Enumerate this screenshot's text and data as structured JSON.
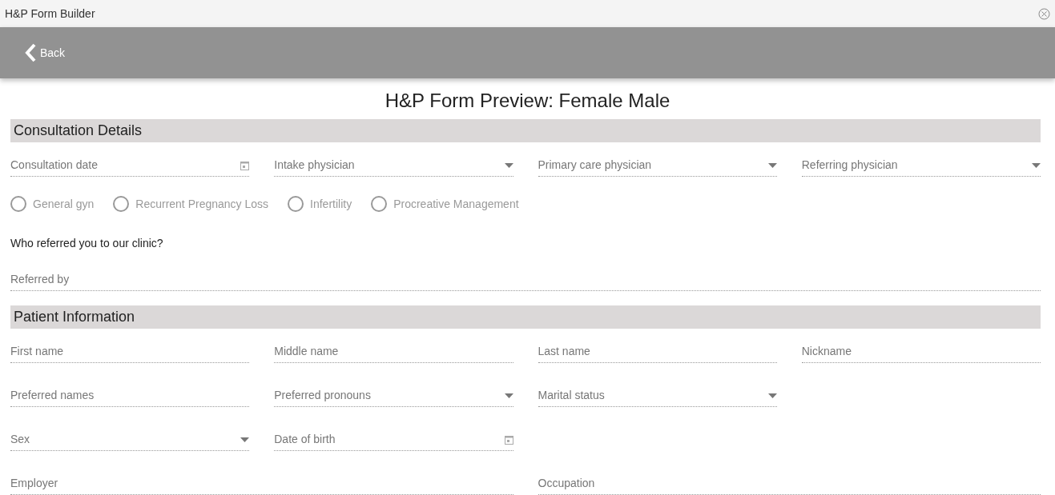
{
  "window": {
    "title": "H&P Form Builder"
  },
  "header": {
    "back_label": "Back"
  },
  "page_title": "H&P Form Preview: Female Male",
  "sections": [
    {
      "title": "Consultation Details",
      "blocks": [
        {
          "kind": "quarters",
          "fields": [
            {
              "kind": "date",
              "placeholder": "Consultation date"
            },
            {
              "kind": "select",
              "placeholder": "Intake physician"
            },
            {
              "kind": "select",
              "placeholder": "Primary care physician"
            },
            {
              "kind": "select",
              "placeholder": "Referring physician"
            }
          ]
        },
        {
          "kind": "radios",
          "options": [
            {
              "label": "General gyn",
              "selected": false,
              "disabled": true
            },
            {
              "label": "Recurrent Pregnancy Loss",
              "selected": false,
              "disabled": true
            },
            {
              "label": "Infertility",
              "selected": false,
              "disabled": true
            },
            {
              "label": "Procreative Management",
              "selected": false,
              "disabled": true
            }
          ]
        },
        {
          "kind": "question",
          "text": "Who referred you to our clinic?"
        },
        {
          "kind": "full",
          "fields": [
            {
              "kind": "text",
              "placeholder": "Referred by"
            }
          ]
        }
      ]
    },
    {
      "title": "Patient Information",
      "blocks": [
        {
          "kind": "quarters",
          "fields": [
            {
              "kind": "text",
              "placeholder": "First name"
            },
            {
              "kind": "text",
              "placeholder": "Middle name"
            },
            {
              "kind": "text",
              "placeholder": "Last name"
            },
            {
              "kind": "text",
              "placeholder": "Nickname"
            }
          ]
        },
        {
          "kind": "quarters",
          "fields": [
            {
              "kind": "text",
              "placeholder": "Preferred names"
            },
            {
              "kind": "select",
              "placeholder": "Preferred pronouns"
            },
            {
              "kind": "select",
              "placeholder": "Marital status"
            }
          ]
        },
        {
          "kind": "quarters",
          "fields": [
            {
              "kind": "select",
              "placeholder": "Sex"
            },
            {
              "kind": "date",
              "placeholder": "Date of birth"
            }
          ]
        },
        {
          "kind": "halves",
          "fields": [
            {
              "kind": "text",
              "placeholder": "Employer"
            },
            {
              "kind": "text",
              "placeholder": "Occupation"
            }
          ]
        }
      ]
    }
  ]
}
